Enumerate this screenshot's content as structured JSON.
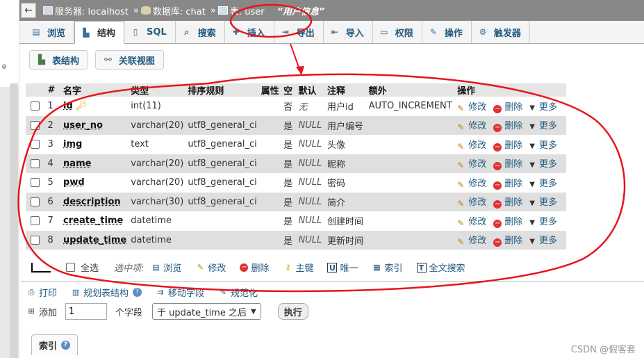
{
  "breadcrumb": {
    "server_label": "服务器: localhost",
    "db_label": "数据库: chat",
    "table_label": "表: user",
    "sep": "»",
    "table_comment": "“用户信息”"
  },
  "tabs": [
    {
      "label": "浏览",
      "icon": "browse-icon"
    },
    {
      "label": "结构",
      "icon": "structure-icon"
    },
    {
      "label": "SQL",
      "icon": "sql-icon"
    },
    {
      "label": "搜索",
      "icon": "search-icon"
    },
    {
      "label": "插入",
      "icon": "insert-icon"
    },
    {
      "label": "导出",
      "icon": "export-icon"
    },
    {
      "label": "导入",
      "icon": "import-icon"
    },
    {
      "label": "权限",
      "icon": "privileges-icon"
    },
    {
      "label": "操作",
      "icon": "operations-icon"
    },
    {
      "label": "触发器",
      "icon": "triggers-icon"
    }
  ],
  "subtabs": {
    "structure": "表结构",
    "relation": "关联视图"
  },
  "table": {
    "headers": [
      "#",
      "名字",
      "类型",
      "排序规则",
      "属性",
      "空",
      "默认",
      "注释",
      "额外",
      "操作"
    ],
    "rows": [
      {
        "num": "1",
        "name": "id",
        "type": "int(11)",
        "collation": "",
        "null": "否",
        "default": "无",
        "comment": "用户id",
        "extra": "AUTO_INCREMENT"
      },
      {
        "num": "2",
        "name": "user_no",
        "type": "varchar(20)",
        "collation": "utf8_general_ci",
        "null": "是",
        "default": "NULL",
        "comment": "用户编号",
        "extra": ""
      },
      {
        "num": "3",
        "name": "img",
        "type": "text",
        "collation": "utf8_general_ci",
        "null": "是",
        "default": "NULL",
        "comment": "头像",
        "extra": ""
      },
      {
        "num": "4",
        "name": "name",
        "type": "varchar(20)",
        "collation": "utf8_general_ci",
        "null": "是",
        "default": "NULL",
        "comment": "昵称",
        "extra": ""
      },
      {
        "num": "5",
        "name": "pwd",
        "type": "varchar(20)",
        "collation": "utf8_general_ci",
        "null": "是",
        "default": "NULL",
        "comment": "密码",
        "extra": ""
      },
      {
        "num": "6",
        "name": "description",
        "type": "varchar(30)",
        "collation": "utf8_general_ci",
        "null": "是",
        "default": "NULL",
        "comment": "简介",
        "extra": ""
      },
      {
        "num": "7",
        "name": "create_time",
        "type": "datetime",
        "collation": "",
        "null": "是",
        "default": "NULL",
        "comment": "创建时间",
        "extra": ""
      },
      {
        "num": "8",
        "name": "update_time",
        "type": "datetime",
        "collation": "",
        "null": "是",
        "default": "NULL",
        "comment": "更新时间",
        "extra": ""
      }
    ],
    "row_actions": {
      "edit": "修改",
      "delete": "删除",
      "more": "更多"
    }
  },
  "bulk": {
    "select_all": "全选",
    "with_selected": "选中项:",
    "actions": [
      "浏览",
      "修改",
      "删除",
      "主键",
      "唯一",
      "索引",
      "全文搜索"
    ]
  },
  "tools": {
    "print": "打印",
    "propose": "规划表结构",
    "move": "移动字段",
    "normalize": "规范化"
  },
  "add": {
    "label": "添加",
    "count": "1",
    "unit": "个字段",
    "position": "于 update_time 之后",
    "go": "执行"
  },
  "index_tab": "索引",
  "watermark": "CSDN @假客套",
  "colors": {
    "topbar": "#888888",
    "link": "#235a81",
    "annotation": "#e8141c",
    "row_alt": "#dfdfdf"
  }
}
